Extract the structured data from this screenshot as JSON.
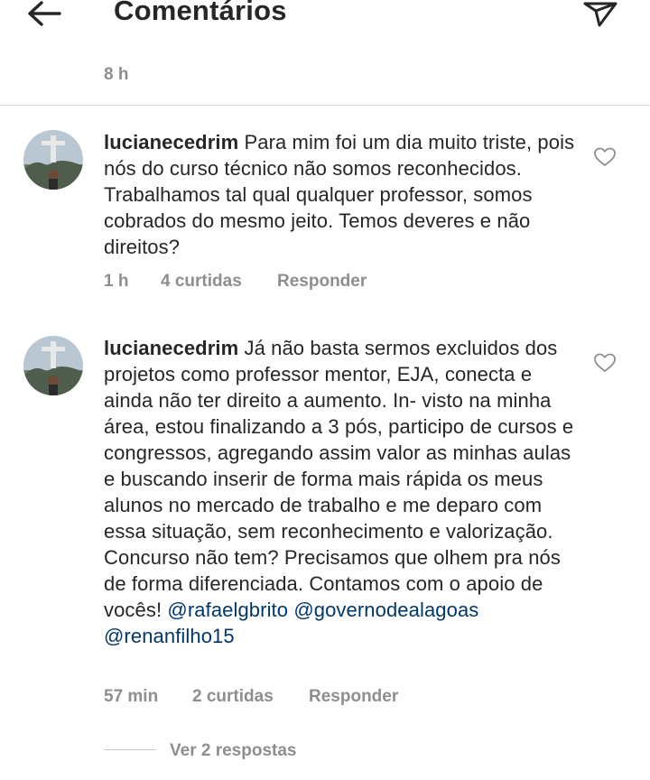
{
  "header": {
    "title": "Comentários"
  },
  "top_item": {
    "time": "8 h"
  },
  "comments": [
    {
      "username": "lucianecedrim",
      "text": " Para mim foi um dia muito triste, pois nós do curso técnico não somos reconhecidos. Trabalhamos tal qual qualquer professor, somos cobrados do mesmo jeito. Temos deveres e não direitos?",
      "time": "1 h",
      "likes": "4 curtidas",
      "reply": "Responder"
    },
    {
      "username": "lucianecedrim",
      "text": " Já não basta sermos excluidos dos projetos como professor mentor, EJA, conecta e ainda não ter direito a aumento. In- visto na minha área, estou finalizando a 3 pós, participo de cursos e congressos, agregando assim valor as minhas aulas e buscando inserir de forma mais rápida os meus alunos no mercado de trabalho e me deparo com essa situação, sem reconhecimento e valorização. Concurso não tem? Precisamos que olhem pra nós de forma diferenciada. Contamos com o apoio de vocês! ",
      "mentions": [
        "@rafaelgbrito",
        "@governodealagoas",
        "@renanfilho15"
      ],
      "time": "57 min",
      "likes": "2 curtidas",
      "reply": "Responder"
    }
  ],
  "view_replies": "Ver 2 respostas",
  "icons": {
    "back": "arrow-left-icon",
    "send": "paper-plane-icon",
    "like": "heart-outline-icon"
  },
  "colors": {
    "text": "#262626",
    "muted": "#8e8e8e",
    "mention": "#00376b",
    "divider": "#dbdbdb"
  }
}
